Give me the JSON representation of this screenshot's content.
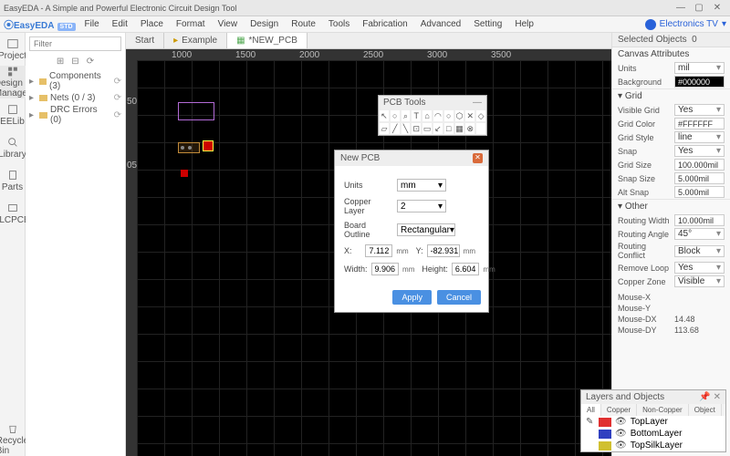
{
  "window": {
    "title": "EasyEDA - A Simple and Powerful Electronic Circuit Design Tool"
  },
  "brand": {
    "name": "EasyEDA",
    "edition": "STD"
  },
  "menu": [
    "File",
    "Edit",
    "Place",
    "Format",
    "View",
    "Design",
    "Route",
    "Tools",
    "Fabrication",
    "Advanced",
    "Setting",
    "Help"
  ],
  "user": {
    "name": "Electronics TV"
  },
  "leftbar": {
    "project": "Project",
    "design_manager": "Design Manager",
    "eelib": "EELib",
    "library": "Library",
    "parts": "Parts",
    "jlcpcb": "JLCPCB",
    "recycle": "Recycle Bin"
  },
  "filter": {
    "placeholder": "Filter"
  },
  "tree": {
    "components": {
      "label": "Components (3)",
      "arrow": "▸"
    },
    "nets": {
      "label": "Nets (0 / 3)",
      "arrow": "▸"
    },
    "drc": {
      "label": "DRC Errors (0)",
      "arrow": "▸"
    }
  },
  "tabs": {
    "start": "Start",
    "example": "Example",
    "newpcb": "*NEW_PCB"
  },
  "ruler_h": [
    "1000",
    "1500",
    "2000",
    "2500",
    "3000",
    "3500"
  ],
  "ruler_v": [
    "50",
    "05"
  ],
  "pcbtools": {
    "title": "PCB Tools",
    "icons": [
      "↖",
      "○",
      "⌕",
      "T",
      "⌂",
      "◠",
      "○",
      "⬡",
      "✕",
      "◇",
      "▱",
      "╱",
      "╲",
      "⊡",
      "▭",
      "↙",
      "□",
      "▦",
      "⊗",
      ""
    ]
  },
  "modal": {
    "title": "New PCB",
    "units_lbl": "Units",
    "units_val": "mm",
    "copper_lbl": "Copper Layer",
    "copper_val": "2",
    "outline_lbl": "Board Outline",
    "outline_val": "Rectangular",
    "x_lbl": "X:",
    "x_val": "7.112",
    "x_unit": "mm",
    "y_lbl": "Y:",
    "y_val": "-82.931",
    "y_unit": "mm",
    "w_lbl": "Width:",
    "w_val": "9.906",
    "w_unit": "mm",
    "h_lbl": "Height:",
    "h_val": "6.604",
    "h_unit": "mm",
    "apply": "Apply",
    "cancel": "Cancel"
  },
  "right": {
    "selected": {
      "lbl": "Selected Objects",
      "val": "0"
    },
    "canvas_attr": "Canvas Attributes",
    "units": {
      "lbl": "Units",
      "val": "mil"
    },
    "background": {
      "lbl": "Background",
      "val": "#000000"
    },
    "grid_section": "Grid",
    "visible_grid": {
      "lbl": "Visible Grid",
      "val": "Yes"
    },
    "grid_color": {
      "lbl": "Grid Color",
      "val": "#FFFFFF"
    },
    "grid_style": {
      "lbl": "Grid Style",
      "val": "line"
    },
    "snap": {
      "lbl": "Snap",
      "val": "Yes"
    },
    "grid_size": {
      "lbl": "Grid Size",
      "val": "100.000mil"
    },
    "snap_size": {
      "lbl": "Snap Size",
      "val": "5.000mil"
    },
    "alt_snap": {
      "lbl": "Alt Snap",
      "val": "5.000mil"
    },
    "other_section": "Other",
    "routing_width": {
      "lbl": "Routing Width",
      "val": "10.000mil"
    },
    "routing_angle": {
      "lbl": "Routing Angle",
      "val": "45°"
    },
    "routing_conflict": {
      "lbl": "Routing Conflict",
      "val": "Block"
    },
    "remove_loop": {
      "lbl": "Remove Loop",
      "val": "Yes"
    },
    "copper_zone": {
      "lbl": "Copper Zone",
      "val": "Visible"
    },
    "mouse_x": "Mouse-X",
    "mouse_y": "Mouse-Y",
    "mouse_dx": {
      "lbl": "Mouse-DX",
      "val": "14.48"
    },
    "mouse_dy": {
      "lbl": "Mouse-DY",
      "val": "113.68"
    }
  },
  "layers": {
    "title": "Layers and Objects",
    "tabs": [
      "All",
      "Copper",
      "Non-Copper",
      "Object"
    ],
    "rows": [
      {
        "color": "#e03030",
        "name": "TopLayer",
        "pen": true
      },
      {
        "color": "#3040c0",
        "name": "BottomLayer",
        "pen": false
      },
      {
        "color": "#d0c030",
        "name": "TopSilkLayer",
        "pen": false
      }
    ]
  }
}
